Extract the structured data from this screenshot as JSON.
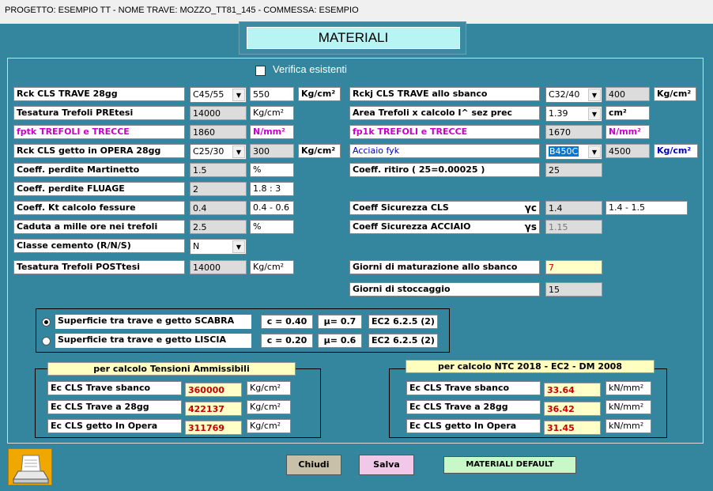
{
  "header": {
    "project_title": "PROGETTO: ESEMPIO TT - NOME TRAVE: MOZZO_TT81_145 - COMMESSA: ESEMPIO",
    "window_title": "MATERIALI"
  },
  "verifica": {
    "label": "Verifica esistenti",
    "checked": false
  },
  "left": {
    "rck_trave": {
      "label": "Rck CLS TRAVE 28gg",
      "class": "C45/55",
      "value": "550",
      "unit": "Kg/cm²"
    },
    "tesatura_pre": {
      "label": "Tesatura Trefoli PREtesi",
      "value": "14000",
      "unit": "Kg/cm²"
    },
    "fptk": {
      "label": "fptk TREFOLI  e  TRECCE",
      "value": "1860",
      "unit": "N/mm²"
    },
    "rck_opera": {
      "label": "Rck CLS getto in OPERA 28gg",
      "class": "C25/30",
      "value": "300",
      "unit": "Kg/cm²"
    },
    "perdite_mart": {
      "label": "Coeff. perdite Martinetto",
      "value": "1.5",
      "unit": "%"
    },
    "perdite_flu": {
      "label": "Coeff. perdite FLUAGE",
      "value": "2",
      "unit": "1.8 : 3"
    },
    "kt": {
      "label": "Coeff. Kt calcolo fessure",
      "value": "0.4",
      "unit": "0.4 - 0.6"
    },
    "caduta": {
      "label": "Caduta a mille ore nei trefoli",
      "value": "2.5",
      "unit": "%"
    },
    "classe": {
      "label": "Classe cemento (R/N/S)",
      "value": "N"
    },
    "tesatura_post": {
      "label": "Tesatura Trefoli POSTtesi",
      "value": "14000",
      "unit": "Kg/cm²"
    }
  },
  "right": {
    "rckj": {
      "label": "Rckj CLS TRAVE allo sbanco",
      "class": "C32/40",
      "value": "400",
      "unit": "Kg/cm²"
    },
    "area": {
      "label": "Area Trefoli x calcolo I^ sez prec",
      "value": "1.39",
      "unit": "cm²"
    },
    "fp1k": {
      "label": "fp1k TREFOLI  e  TRECCE",
      "value": "1670",
      "unit": "N/mm²"
    },
    "acciaio": {
      "label": "Acciaio fyk",
      "class": "B450C",
      "value": "4500",
      "unit": "Kg/cm²"
    },
    "ritiro": {
      "label": "Coeff. ritiro ( 25=0.00025 )",
      "value": "25"
    },
    "sic_cls": {
      "label": "Coeff Sicurezza CLS",
      "gamma": "γc",
      "value": "1.4",
      "unit": "1.4 - 1.5"
    },
    "sic_acc": {
      "label": "Coeff Sicurezza ACCIAIO",
      "gamma": "γs",
      "value": "1.15"
    },
    "maturazione": {
      "label": "Giorni di maturazione allo sbanco",
      "value": "7"
    },
    "stoccaggio": {
      "label": "Giorni di stoccaggio",
      "value": "15"
    }
  },
  "surface": {
    "scabra": {
      "label": "Superficie tra trave e getto SCABRA",
      "c": "c = 0.40",
      "mu": "μ= 0.7",
      "ref": "EC2 6.2.5 (2)",
      "selected": true
    },
    "liscia": {
      "label": "Superficie tra trave e getto LISCIA",
      "c": "c = 0.20",
      "mu": "μ= 0.6",
      "ref": "EC2 6.2.5 (2)",
      "selected": false
    }
  },
  "tensioni": {
    "title": "per calcolo Tensioni Ammissibili",
    "rows": [
      {
        "label": "Ec CLS Trave sbanco",
        "value": "360000",
        "unit": "Kg/cm²"
      },
      {
        "label": "Ec CLS Trave a 28gg",
        "value": "422137",
        "unit": "Kg/cm²"
      },
      {
        "label": "Ec CLS getto In Opera",
        "value": "311769",
        "unit": "Kg/cm²"
      }
    ]
  },
  "ntc": {
    "title": "per calcolo NTC 2018 - EC2 - DM 2008",
    "rows": [
      {
        "label": "Ec CLS Trave sbanco",
        "value": "33.64",
        "unit": "kN/mm²"
      },
      {
        "label": "Ec CLS Trave a 28gg",
        "value": "36.42",
        "unit": "kN/mm²"
      },
      {
        "label": "Ec CLS getto In Opera",
        "value": "31.45",
        "unit": "kN/mm²"
      }
    ]
  },
  "buttons": {
    "chiudi": "Chiudi",
    "salva": "Salva",
    "default": "MATERIALI DEFAULT"
  },
  "colors": {
    "background": "#34869e",
    "title": "#b8f4f4",
    "pane_title": "#ffffc0",
    "chiudi": "#c8c0a8",
    "salva": "#f2c8e8",
    "default": "#c8f8c8",
    "printer": "#f0a800"
  }
}
